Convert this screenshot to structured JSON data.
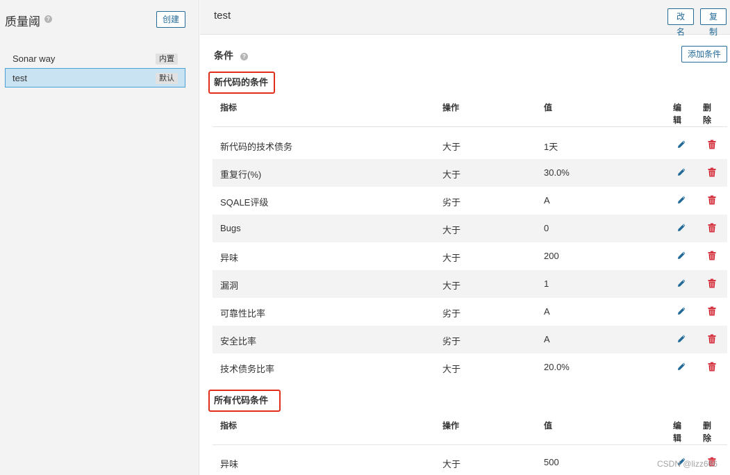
{
  "sidebar": {
    "title": "质量阈",
    "help": "?",
    "create_label": "创建",
    "items": [
      {
        "name": "Sonar way",
        "tag": "内置"
      },
      {
        "name": "test",
        "tag": "默认"
      }
    ]
  },
  "main": {
    "title": "test",
    "rename_label": "改名",
    "copy_label": "复制",
    "conditions_title": "条件",
    "help": "?",
    "add_condition_label": "添加条件",
    "headers": {
      "metric": "指标",
      "operator": "操作",
      "value": "值",
      "edit": "编辑",
      "delete": "删除"
    },
    "new_code": {
      "label": "新代码的条件",
      "rows": [
        {
          "metric": "新代码的技术债务",
          "operator": "大于",
          "value": "1天"
        },
        {
          "metric": "重复行(%)",
          "operator": "大于",
          "value": "30.0%"
        },
        {
          "metric": "SQALE评级",
          "operator": "劣于",
          "value": "A"
        },
        {
          "metric": "Bugs",
          "operator": "大于",
          "value": "0"
        },
        {
          "metric": "异味",
          "operator": "大于",
          "value": "200"
        },
        {
          "metric": "漏洞",
          "operator": "大于",
          "value": "1"
        },
        {
          "metric": "可靠性比率",
          "operator": "劣于",
          "value": "A"
        },
        {
          "metric": "安全比率",
          "operator": "劣于",
          "value": "A"
        },
        {
          "metric": "技术债务比率",
          "operator": "大于",
          "value": "20.0%"
        }
      ]
    },
    "overall": {
      "label": "所有代码条件",
      "rows": [
        {
          "metric": "异味",
          "operator": "大于",
          "value": "500"
        }
      ]
    }
  },
  "watermark": "CSDN @lizz666",
  "colors": {
    "accent": "#236a97",
    "edit_icon": "#236a97",
    "delete_icon": "#d4333f",
    "highlight_box": "#e02d1c",
    "selected_bg": "#cae3f2"
  }
}
